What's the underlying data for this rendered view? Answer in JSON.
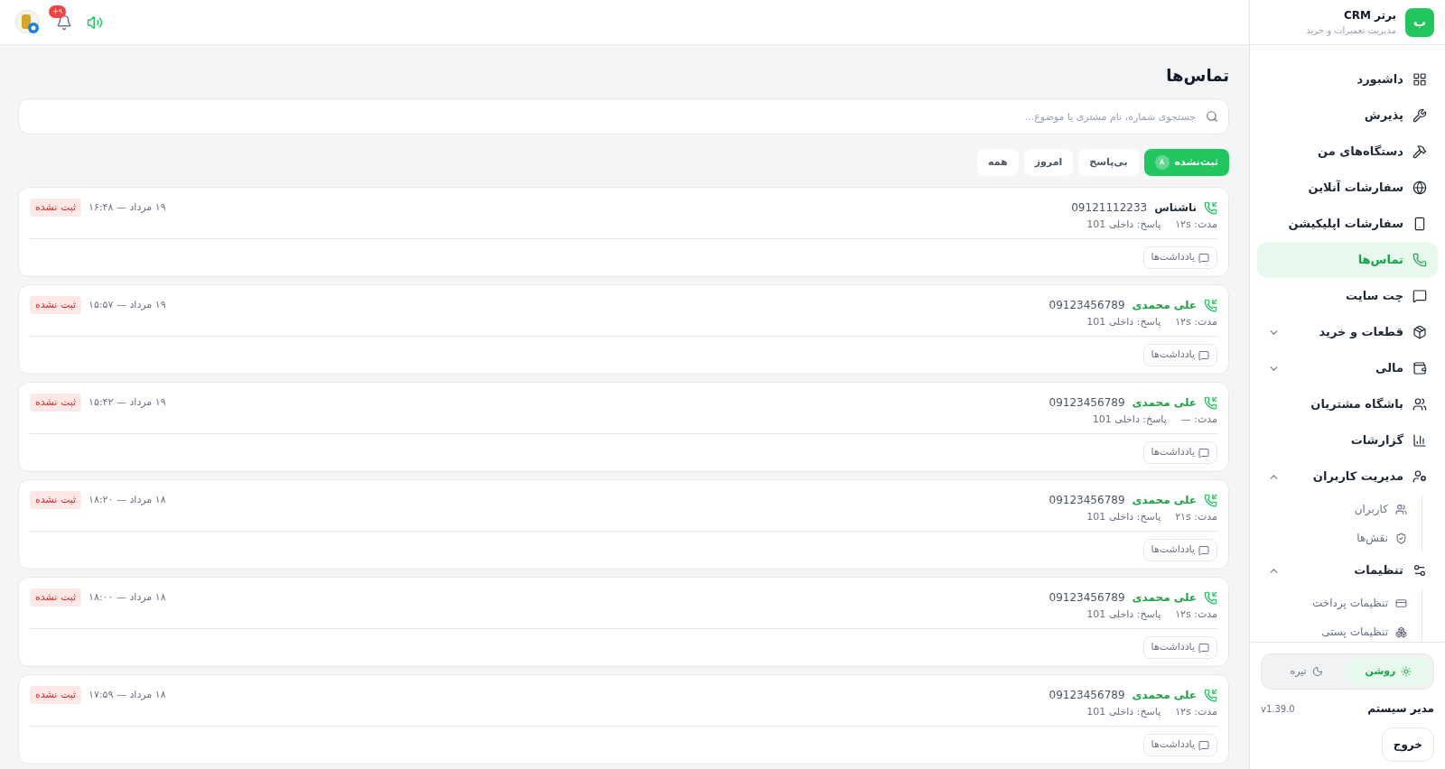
{
  "header": {
    "notification_count": "+۹"
  },
  "brand": {
    "logo": "ب",
    "name": "برتر CRM",
    "subtitle": "مدیریت تعمیرات و خرید"
  },
  "nav": [
    {
      "kind": "link",
      "label": "داشبورد",
      "selected": false
    },
    {
      "kind": "link",
      "label": "پذیرش",
      "selected": false
    },
    {
      "kind": "link",
      "label": "دستگاه‌های من",
      "selected": false
    },
    {
      "kind": "link",
      "label": "سفارشات آنلاین",
      "selected": false
    },
    {
      "kind": "link",
      "label": "سفارشات اپلیکیشن",
      "selected": false
    },
    {
      "kind": "link",
      "label": "تماس‌ها",
      "selected": true
    },
    {
      "kind": "link",
      "label": "چت سایت",
      "selected": false
    },
    {
      "kind": "group",
      "label": "قطعات و خرید",
      "selected": false,
      "expanded": false
    },
    {
      "kind": "group",
      "label": "مالی",
      "selected": false,
      "expanded": false
    },
    {
      "kind": "link",
      "label": "باشگاه مشتریان",
      "selected": false
    },
    {
      "kind": "link",
      "label": "گزارشات",
      "selected": false
    },
    {
      "kind": "group",
      "label": "مدیریت کاربران",
      "selected": false,
      "expanded": true,
      "children": [
        {
          "label": "کاربران",
          "selected": false
        },
        {
          "label": "نقش‌ها",
          "selected": false
        }
      ]
    },
    {
      "kind": "group",
      "label": "تنظیمات",
      "selected": false,
      "expanded": true,
      "children": [
        {
          "label": "تنظیمات پرداخت",
          "selected": false
        },
        {
          "label": "تنظیمات پستی",
          "selected": false
        }
      ]
    }
  ],
  "theme": [
    {
      "label": "روشن",
      "selected": true
    },
    {
      "label": "تیره",
      "selected": false
    }
  ],
  "user": {
    "name": "مدیر سیستم",
    "version": "v1.39.0"
  },
  "logout": "خروج",
  "page": {
    "title": "تماس‌ها",
    "search": {
      "placeholder": "جستجوی شماره، نام مشتری یا موضوع..."
    },
    "filters": [
      {
        "label": "ثبت‌نشده",
        "count": "۸",
        "selected": true
      },
      {
        "label": "بی‌پاسخ",
        "selected": false
      },
      {
        "label": "امروز",
        "selected": false
      },
      {
        "label": "همه",
        "selected": false
      }
    ],
    "calls": [
      {
        "name": "ناشناس",
        "known": false,
        "number": "09121112233",
        "duration": "مدت: ۱۲s",
        "answer": "پاسخ: داخلی 101",
        "time": "۱۹ مرداد — ۱۶:۴۸",
        "status": "ثبت نشده",
        "notes": "یادداشت‌ها"
      },
      {
        "name": "علی محمدی",
        "known": true,
        "number": "09123456789",
        "duration": "مدت: ۱۲s",
        "answer": "پاسخ: داخلی 101",
        "time": "۱۹ مرداد — ۱۵:۵۷",
        "status": "ثبت نشده",
        "notes": "یادداشت‌ها"
      },
      {
        "name": "علی محمدی",
        "known": true,
        "number": "09123456789",
        "duration": "مدت: —",
        "answer": "پاسخ: داخلی 101",
        "time": "۱۹ مرداد — ۱۵:۴۲",
        "status": "ثبت نشده",
        "notes": "یادداشت‌ها"
      },
      {
        "name": "علی محمدی",
        "known": true,
        "number": "09123456789",
        "duration": "مدت: ۲۱s",
        "answer": "پاسخ: داخلی 101",
        "time": "۱۸ مرداد — ۱۸:۲۰",
        "status": "ثبت نشده",
        "notes": "یادداشت‌ها"
      },
      {
        "name": "علی محمدی",
        "known": true,
        "number": "09123456789",
        "duration": "مدت: ۱۲s",
        "answer": "پاسخ: داخلی 101",
        "time": "۱۸ مرداد — ۱۸:۰۰",
        "status": "ثبت نشده",
        "notes": "یادداشت‌ها"
      },
      {
        "name": "علی محمدی",
        "known": true,
        "number": "09123456789",
        "duration": "مدت: ۱۲s",
        "answer": "پاسخ: داخلی 101",
        "time": "۱۸ مرداد — ۱۷:۵۹",
        "status": "ثبت نشده",
        "notes": "یادداشت‌ها"
      }
    ]
  }
}
